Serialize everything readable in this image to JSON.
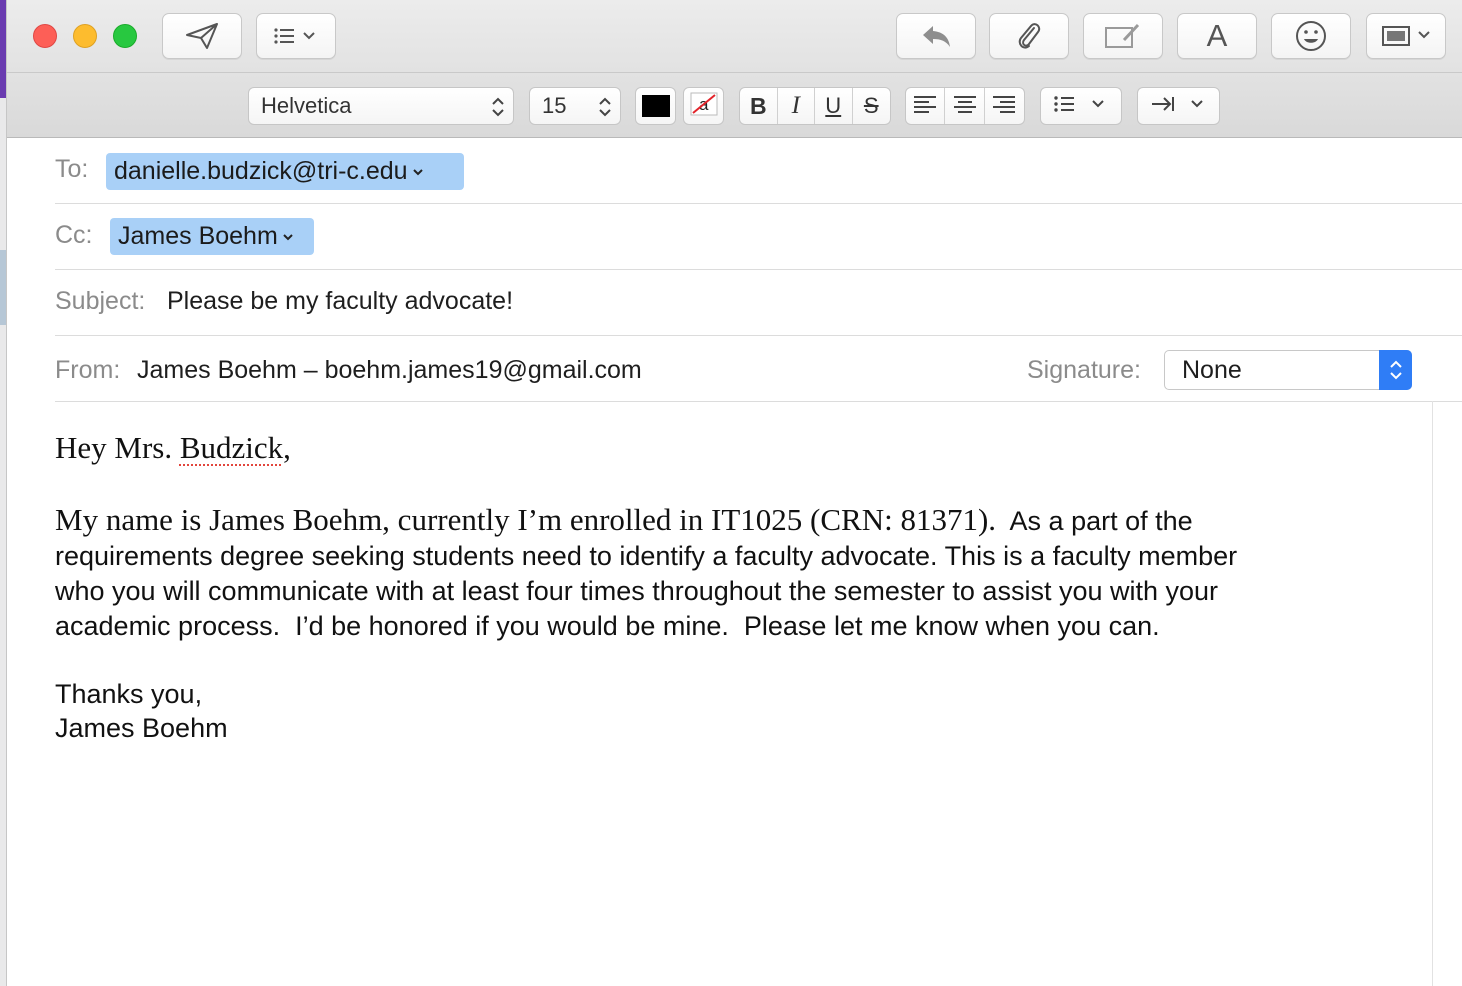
{
  "toolbar": {
    "send_icon": "paper-plane-icon",
    "header_fields_icon": "list-chevron-icon",
    "reply_icon": "reply-arrow-icon",
    "attach_icon": "paperclip-icon",
    "markup_icon": "markup-pen-icon",
    "format_icon": "letter-a-icon",
    "format_letter": "A",
    "emoji_icon": "smiley-icon",
    "photo_icon": "photo-browser-icon"
  },
  "format_bar": {
    "font": "Helvetica",
    "size": "15",
    "bold": "B",
    "italic": "I",
    "underline": "U",
    "strike": "S",
    "text_color": "#000000"
  },
  "header": {
    "to_label": "To:",
    "to_recipient": "danielle.budzick@tri-c.edu",
    "cc_label": "Cc:",
    "cc_recipient": "James Boehm",
    "subject_label": "Subject:",
    "subject": "Please be my faculty advocate!",
    "from_label": "From:",
    "from_value": "James Boehm – boehm.james19@gmail.com",
    "signature_label": "Signature:",
    "signature_value": "None"
  },
  "body": {
    "greeting_prefix": "Hey Mrs. ",
    "greeting_name": "Budzick",
    "greeting_suffix": ",",
    "para_serif": "My name is James Boehm, currently I’m enrolled in IT1025 (CRN: 81371).",
    "para_sans_1": "  As a part of the",
    "para_line2": "requirements degree seeking students need to identify a faculty advocate. This is a faculty member",
    "para_line3": "who you will communicate with at least four times throughout the semester to assist you with your",
    "para_line4": "academic process.  I’d be honored if you would be mine.  Please let me know when you can.",
    "closing": "Thanks you,",
    "signature_name": "James Boehm"
  },
  "colors": {
    "token_bg": "#a9d0f7",
    "accent": "#2f7df6",
    "close": "#fd5f57",
    "minimize": "#fdbc2e",
    "zoom": "#28c840"
  }
}
